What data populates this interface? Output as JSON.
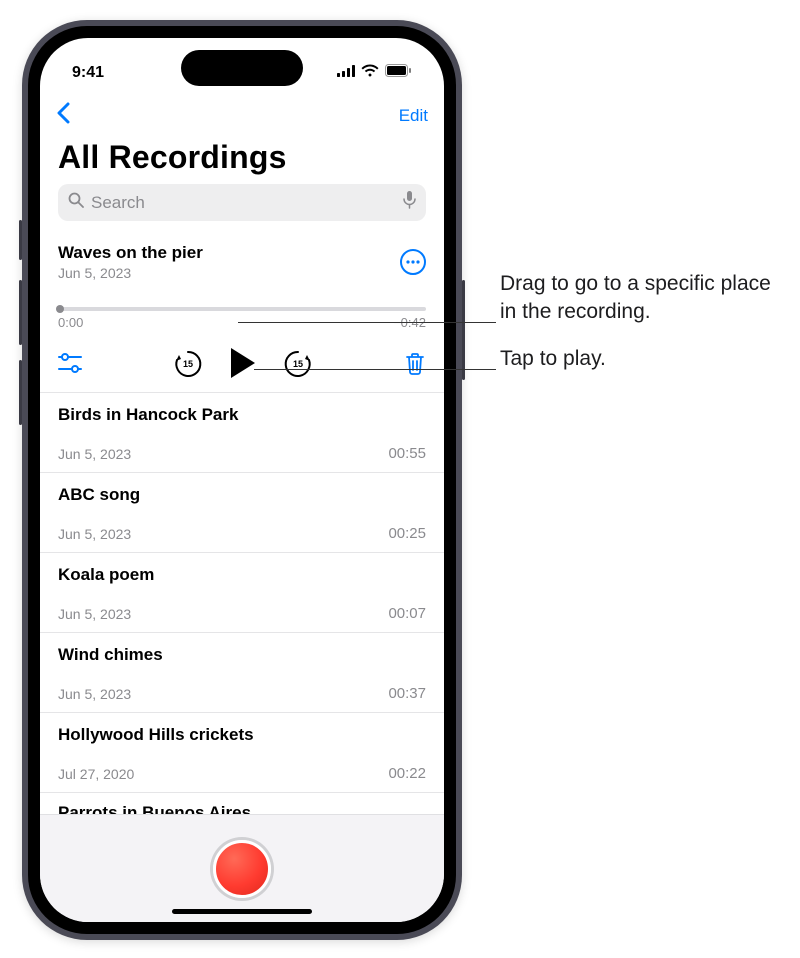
{
  "status": {
    "time": "9:41"
  },
  "nav": {
    "edit_label": "Edit"
  },
  "page": {
    "title": "All Recordings"
  },
  "search": {
    "placeholder": "Search"
  },
  "expanded": {
    "title": "Waves on the pier",
    "date": "Jun 5, 2023",
    "elapsed": "0:00",
    "remaining": "−0:42",
    "skip_seconds": "15"
  },
  "recordings": [
    {
      "title": "Birds in Hancock Park",
      "date": "Jun 5, 2023",
      "duration": "00:55"
    },
    {
      "title": "ABC song",
      "date": "Jun 5, 2023",
      "duration": "00:25"
    },
    {
      "title": "Koala poem",
      "date": "Jun 5, 2023",
      "duration": "00:07"
    },
    {
      "title": "Wind chimes",
      "date": "Jun 5, 2023",
      "duration": "00:37"
    },
    {
      "title": "Hollywood Hills crickets",
      "date": "Jul 27, 2020",
      "duration": "00:22"
    }
  ],
  "partial": {
    "title": "Parrots in Buenos Aires"
  },
  "callouts": {
    "scrubber": "Drag to go to a specific place in the recording.",
    "play": "Tap to play."
  }
}
